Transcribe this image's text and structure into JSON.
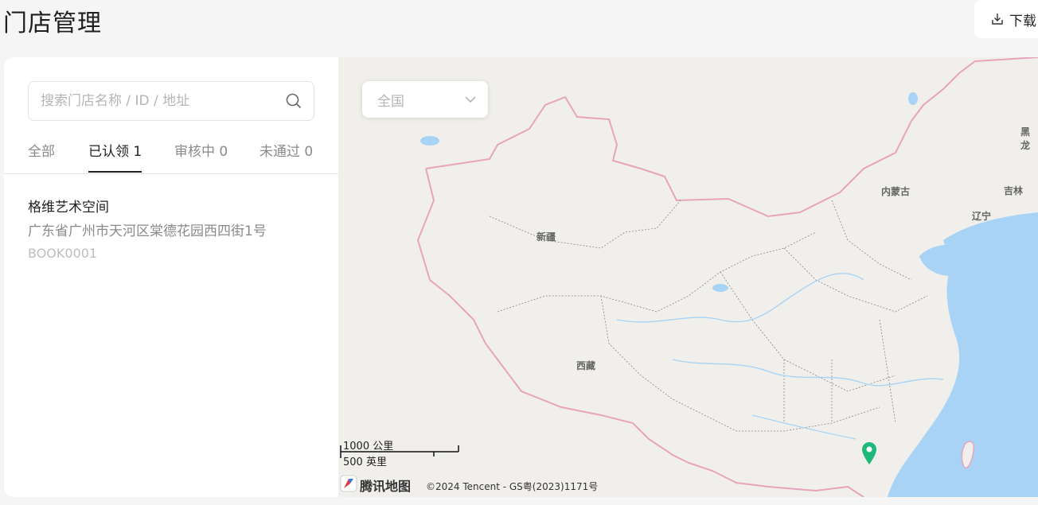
{
  "header": {
    "title": "门店管理",
    "download_label": "下载"
  },
  "search": {
    "placeholder": "搜索门店名称 / ID / 地址",
    "value": ""
  },
  "tabs": [
    {
      "label": "全部",
      "active": false
    },
    {
      "label": "已认领 1",
      "active": true
    },
    {
      "label": "审核中 0",
      "active": false
    },
    {
      "label": "未通过 0",
      "active": false
    }
  ],
  "stores": [
    {
      "name": "格维艺术空间",
      "address": "广东省广州市天河区棠德花园西四街1号",
      "id": "BOOK0001"
    }
  ],
  "map": {
    "region_select": "全国",
    "labels": {
      "xinjiang": "新疆",
      "xizang": "西藏",
      "neimenggu": "内蒙古",
      "jilin": "吉林",
      "liaoning": "辽宁",
      "heilongjiang": "黑龙"
    },
    "scale": {
      "km": "1000 公里",
      "miles": "500 英里"
    },
    "logo_text": "腾讯地图",
    "copyright": "©2024 Tencent - GS粤(2023)1171号",
    "marker_color": "#1db97a",
    "water_color": "#a9d3f5",
    "border_color": "#e8a3bd"
  },
  "icons": [
    "download-icon",
    "search-icon",
    "chevron-down-icon",
    "map-pin-icon",
    "tencent-map-logo-icon"
  ]
}
